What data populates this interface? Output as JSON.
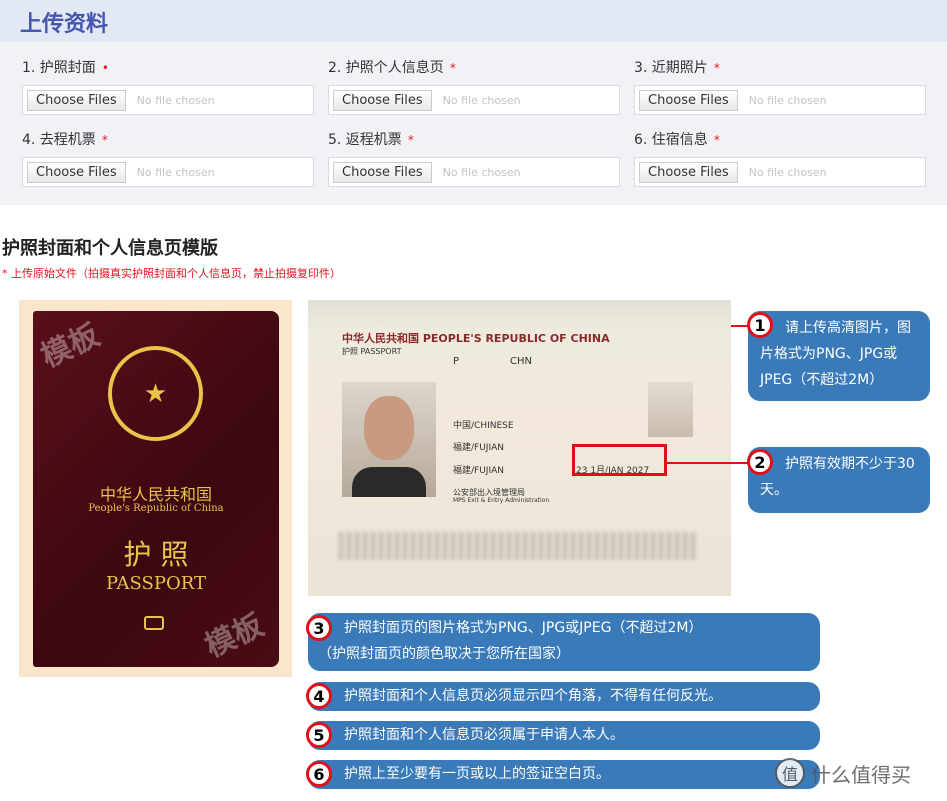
{
  "header": {
    "title": "上传资料"
  },
  "form": {
    "button_label": "Choose Files",
    "no_file": "No file chosen",
    "fields": [
      {
        "label": "1. 护照封面",
        "required": "•"
      },
      {
        "label": "2. 护照个人信息页",
        "required": "*"
      },
      {
        "label": "3. 近期照片",
        "required": "*"
      },
      {
        "label": "4. 去程机票",
        "required": "*"
      },
      {
        "label": "5. 返程机票",
        "required": "*"
      },
      {
        "label": "6. 住宿信息",
        "required": "*"
      }
    ]
  },
  "section": {
    "title": "护照封面和个人信息页模版",
    "note": "* 上传原始文件（拍摄真实护照封面和个人信息页，禁止拍摄复印件）"
  },
  "cover": {
    "watermark": "模板",
    "cn": "中华人民共和国",
    "en": "People's Republic of China",
    "title_cn": "护 照",
    "title_en": "PASSPORT"
  },
  "datapage": {
    "header": "中华人民共和国  PEOPLE'S REPUBLIC OF CHINA",
    "type_label": "护照 PASSPORT",
    "type": "P",
    "country": "CHN",
    "nationality": "中国/CHINESE",
    "birth_place": "福建/FUJIAN",
    "issue_place": "福建/FUJIAN",
    "expiry": "23 1月/JAN 2027",
    "authority": "公安部出入境管理局",
    "authority_en": "MPS Exit & Entry Administration"
  },
  "callouts": [
    {
      "n": "1",
      "text": "请上传高清图片，图片格式为PNG、JPG或JPEG（不超过2M）"
    },
    {
      "n": "2",
      "text": "护照有效期不少于30天。"
    },
    {
      "n": "3",
      "text": "护照封面页的图片格式为PNG、JPG或JPEG（不超过2M）",
      "text2": "（护照封面页的颜色取决于您所在国家）"
    },
    {
      "n": "4",
      "text": "护照封面和个人信息页必须显示四个角落，不得有任何反光。"
    },
    {
      "n": "5",
      "text": "护照封面和个人信息页必须属于申请人本人。"
    },
    {
      "n": "6",
      "text": "护照上至少要有一页或以上的签证空白页。"
    }
  ],
  "watermark_logo": {
    "icon": "值",
    "text": "什么值得买"
  },
  "colors": {
    "accent": "#3a7ab9",
    "required": "#e0202a",
    "header_bg": "#e3e9f4"
  }
}
